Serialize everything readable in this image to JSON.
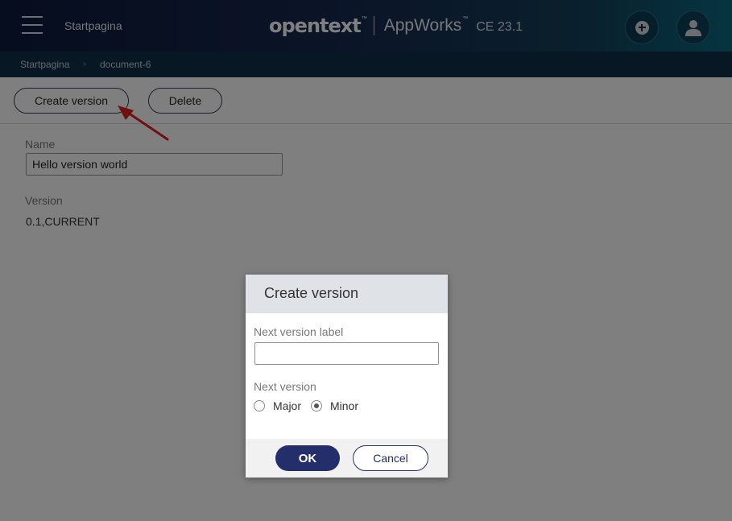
{
  "header": {
    "home_link": "Startpagina",
    "brand_name": "opentext",
    "tm": "™",
    "product": "AppWorks",
    "version": "CE 23.1",
    "icons": {
      "menu": "hamburger-icon",
      "add": "plus-circle-icon",
      "user": "user-icon"
    }
  },
  "breadcrumb": {
    "home": "Startpagina",
    "separator": "›",
    "current": "document-6"
  },
  "toolbar": {
    "create_label": "Create version",
    "delete_label": "Delete"
  },
  "form": {
    "name_label": "Name",
    "name_value": "Hello version world",
    "version_label": "Version",
    "version_value": "0.1,CURRENT"
  },
  "dialog": {
    "title": "Create version",
    "label_field_label": "Next version label",
    "label_field_value": "",
    "next_version_label": "Next version",
    "options": [
      {
        "label": "Major",
        "selected": false
      },
      {
        "label": "Minor",
        "selected": true
      }
    ],
    "ok_label": "OK",
    "cancel_label": "Cancel"
  },
  "colors": {
    "header_start": "#0c1a3c",
    "header_end": "#0b6a83",
    "primary_button": "#232e6a",
    "annotation_arrow": "#e02020"
  }
}
